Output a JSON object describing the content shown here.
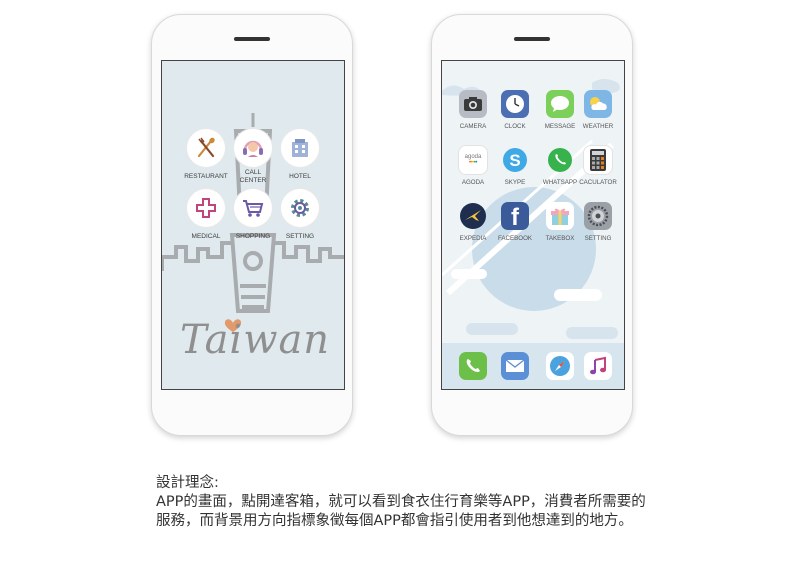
{
  "left_phone": {
    "apps": [
      {
        "label": "RESTAURANT",
        "icon": "fork-spoon-icon"
      },
      {
        "label": "CALL\nCENTER",
        "icon": "headset-icon"
      },
      {
        "label": "HOTEL",
        "icon": "building-icon"
      },
      {
        "label": "MEDICAL",
        "icon": "cross-icon"
      },
      {
        "label": "SHOPPING",
        "icon": "cart-icon"
      },
      {
        "label": "SETTING",
        "icon": "gear-icon"
      }
    ],
    "logo_text": "Taiwan",
    "colors": {
      "screen": "#dfe9ee",
      "tower": "#a9acae",
      "heart": "#e29a6a",
      "logo": "#8f8f8f"
    }
  },
  "right_phone": {
    "apps": [
      {
        "label": "CAMERA",
        "icon": "camera-icon"
      },
      {
        "label": "CLOCK",
        "icon": "clock-icon"
      },
      {
        "label": "MESSAGE",
        "icon": "message-icon"
      },
      {
        "label": "WEATHER",
        "icon": "weather-icon"
      },
      {
        "label": "AGODA",
        "icon": "agoda-icon",
        "icon_text": "agoda"
      },
      {
        "label": "SKYPE",
        "icon": "skype-icon"
      },
      {
        "label": "WHATSAPP",
        "icon": "whatsapp-icon"
      },
      {
        "label": "CACULATOR",
        "icon": "calculator-icon"
      },
      {
        "label": "EXPEDIA",
        "icon": "expedia-icon"
      },
      {
        "label": "FACEBOOK",
        "icon": "facebook-icon"
      },
      {
        "label": "TAKEBOX",
        "icon": "gift-icon"
      },
      {
        "label": "SETTING",
        "icon": "settings-icon"
      }
    ],
    "dock": [
      {
        "icon": "phone-icon"
      },
      {
        "icon": "mail-icon"
      },
      {
        "icon": "safari-icon"
      },
      {
        "icon": "music-icon"
      }
    ]
  },
  "caption": {
    "title": "設計理念:",
    "line1": "APP的畫面，點開達客箱，就可以看到食衣住行育樂等APP，消費者所需要的",
    "line2": "服務，而背景用方向指標象徵每個APP都會指引使用者到他想達到的地方。"
  }
}
